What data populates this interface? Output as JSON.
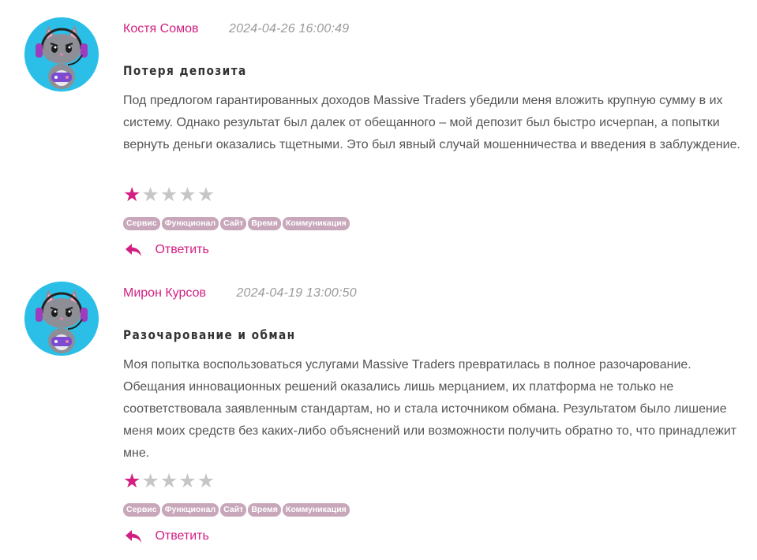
{
  "reviews": [
    {
      "author": "Костя Сомов",
      "date": "2024-04-26 16:00:49",
      "title": "Потеря депозита",
      "text": "Под предлогом гарантированных доходов Massive Traders убедили меня вложить крупную сумму в их систему. Однако результат был далек от обещанного – мой депозит был быстро исчерпан, а попытки вернуть деньги оказались тщетными. Это был явный случай мошенничества и введения в заблуждение.",
      "rating": 1,
      "rating_max": 5,
      "tags": [
        "Сервис",
        "Функционал",
        "Сайт",
        "Время",
        "Коммуникация"
      ],
      "reply_label": "Ответить",
      "avatar_icon": "cat-gamer-headset-avatar"
    },
    {
      "author": "Мирон Курсов",
      "date": "2024-04-19 13:00:50",
      "title": "Разочарование и обман",
      "text": "Моя попытка воспользоваться услугами Massive Traders превратилась в полное разочарование. Обещания инновационных решений оказались лишь мерцанием, их платформа не только не соответствовала заявленным стандартам, но и стала источником обмана. Результатом было лишение меня моих средств без каких-либо объяснений или возможности получить обратно то, что принадлежит мне.",
      "rating": 1,
      "rating_max": 5,
      "tags": [
        "Сервис",
        "Функционал",
        "Сайт",
        "Время",
        "Коммуникация"
      ],
      "reply_label": "Ответить",
      "avatar_icon": "cat-gamer-headset-avatar"
    }
  ],
  "colors": {
    "accent": "#d21f82",
    "tag_bg": "#c8a7ba",
    "avatar_bg": "#2bbfe8",
    "star_empty": "#c6c6c6"
  }
}
